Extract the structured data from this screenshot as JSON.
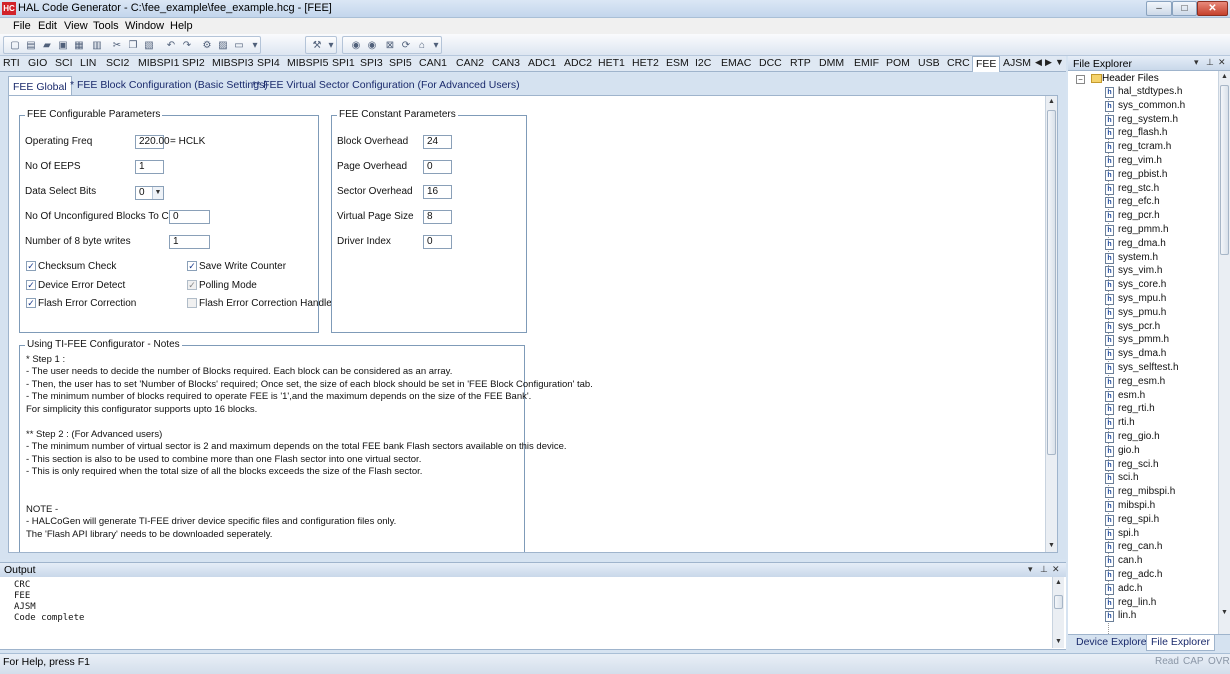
{
  "window": {
    "title": "HAL Code Generator - C:\\fee_example\\fee_example.hcg - [FEE]",
    "app_badge": "HC",
    "controls": {
      "minimize": "–",
      "maximize": "□",
      "close": "✕"
    }
  },
  "menu": [
    "File",
    "Edit",
    "View",
    "Tools",
    "Window",
    "Help"
  ],
  "module_tabs": [
    "RTI",
    "GIO",
    "SCI",
    "LIN",
    "SCI2",
    "MIBSPI1",
    "SPI2",
    "MIBSPI3",
    "SPI4",
    "MIBSPI5",
    "SPI1",
    "SPI3",
    "SPI5",
    "CAN1",
    "CAN2",
    "CAN3",
    "ADC1",
    "ADC2",
    "HET1",
    "HET2",
    "ESM",
    "I2C",
    "EMAC",
    "DCC",
    "RTP",
    "DMM",
    "EMIF",
    "POM",
    "USB",
    "CRC",
    "FEE",
    "AJSM"
  ],
  "active_module_tab": "FEE",
  "sub_tabs": [
    "FEE Global",
    "* FEE Block Configuration (Basic Settings)",
    "** FEE Virtual Sector Configuration (For Advanced Users)"
  ],
  "configurable": {
    "title": "FEE Configurable Parameters",
    "operating_freq_label": "Operating Freq",
    "operating_freq_value": "220.00",
    "operating_freq_unit": "=   HCLK",
    "eeps_label": "No Of EEPS",
    "eeps_value": "1",
    "data_select_label": "Data Select Bits",
    "data_select_value": "0",
    "unconfigured_label": "No Of Unconfigured Blocks To Copy",
    "unconfigured_value": "0",
    "writes_label": "Number of 8 byte writes",
    "writes_value": "1",
    "checksum_label": "Checksum Check",
    "save_write_label": "Save Write Counter",
    "device_error_label": "Device Error Detect",
    "polling_label": "Polling Mode",
    "flash_error_label": "Flash Error Correction",
    "flash_error_handle_label": "Flash Error Correction Handle"
  },
  "constants": {
    "title": "FEE Constant Parameters",
    "block_overhead_label": "Block Overhead",
    "block_overhead_value": "24",
    "page_overhead_label": "Page Overhead",
    "page_overhead_value": "0",
    "sector_overhead_label": "Sector Overhead",
    "sector_overhead_value": "16",
    "virtual_page_label": "Virtual Page Size",
    "virtual_page_value": "8",
    "driver_index_label": "Driver Index",
    "driver_index_value": "0"
  },
  "notes": {
    "title": "Using TI-FEE Configurator - Notes",
    "lines": [
      "*  Step 1 :",
      "- The user needs to decide the number of Blocks required. Each block can be considered as an array.",
      "- Then, the user has to set 'Number of Blocks' required; Once set, the size of each block should be set in 'FEE Block Configuration' tab.",
      "- The minimum number of blocks required to operate FEE is '1',and the maximum depends on the size of the FEE Bank'.",
      "   For simplicity this configurator supports upto 16 blocks.",
      "",
      "** Step 2 : (For Advanced users)",
      "- The minimum number of virtual sector is 2 and maximum depends on the total FEE bank Flash sectors available on this device.",
      "- This section is also to be used to combine more than one Flash sector into one virtual sector.",
      "- This is only required when the total size of all the blocks exceeds the size of the Flash sector.",
      "",
      "",
      "     NOTE -",
      "- HALCoGen will generate TI-FEE driver device specific files and configuration files only.",
      "  The 'Flash API library' needs to be downloaded seperately."
    ]
  },
  "output": {
    "title": "Output",
    "lines": [
      "CRC",
      "FEE",
      "AJSM",
      "Code complete"
    ]
  },
  "file_explorer": {
    "title": "File Explorer",
    "root": "Header Files",
    "files": [
      "hal_stdtypes.h",
      "sys_common.h",
      "reg_system.h",
      "reg_flash.h",
      "reg_tcram.h",
      "reg_vim.h",
      "reg_pbist.h",
      "reg_stc.h",
      "reg_efc.h",
      "reg_pcr.h",
      "reg_pmm.h",
      "reg_dma.h",
      "system.h",
      "sys_vim.h",
      "sys_core.h",
      "sys_mpu.h",
      "sys_pmu.h",
      "sys_pcr.h",
      "sys_pmm.h",
      "sys_dma.h",
      "sys_selftest.h",
      "reg_esm.h",
      "esm.h",
      "reg_rti.h",
      "rti.h",
      "reg_gio.h",
      "gio.h",
      "reg_sci.h",
      "sci.h",
      "reg_mibspi.h",
      "mibspi.h",
      "reg_spi.h",
      "spi.h",
      "reg_can.h",
      "can.h",
      "reg_adc.h",
      "adc.h",
      "reg_lin.h",
      "lin.h"
    ],
    "tabs": [
      "Device Explorer",
      "File Explorer"
    ]
  },
  "status": {
    "text": "For Help, press F1",
    "indicators": [
      "Read",
      "CAP",
      "OVR"
    ]
  }
}
